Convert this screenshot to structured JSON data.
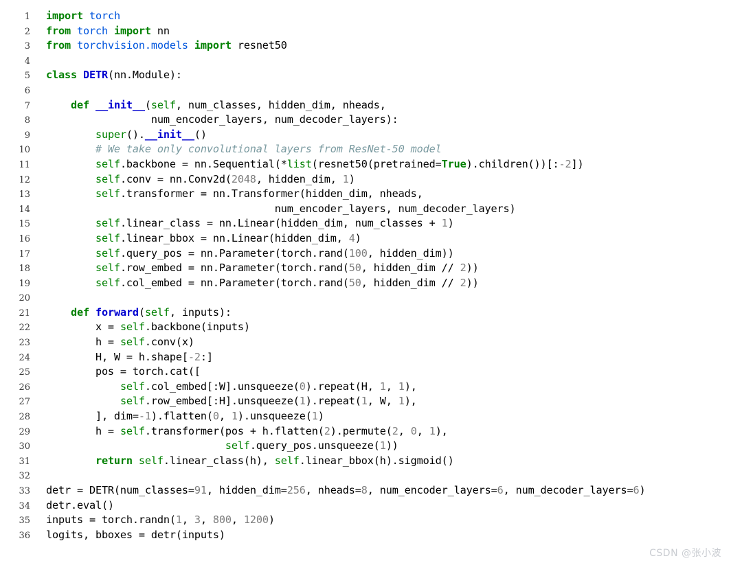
{
  "editor": {
    "language": "python",
    "background_color": "#ffffff",
    "line_number_color": "#3b3b3b",
    "first_line": 1,
    "last_line": 36,
    "total_lines": 36
  },
  "theme": {
    "keyword_color": "#008000",
    "name_color": "#0000d0",
    "module_color": "#0055dd",
    "number_color": "#7d7d7d",
    "comment_color": "#7a9aa0",
    "text_color": "#000000"
  },
  "watermark": {
    "text": "CSDN @张小波",
    "color": "#c9ccd1"
  },
  "lines": [
    {
      "n": "1",
      "tokens": [
        {
          "t": "import",
          "c": "kw"
        },
        {
          "t": " ",
          "c": "plain"
        },
        {
          "t": "torch",
          "c": "mod"
        }
      ]
    },
    {
      "n": "2",
      "tokens": [
        {
          "t": "from",
          "c": "kw"
        },
        {
          "t": " ",
          "c": "plain"
        },
        {
          "t": "torch",
          "c": "mod"
        },
        {
          "t": " ",
          "c": "plain"
        },
        {
          "t": "import",
          "c": "kw"
        },
        {
          "t": " nn",
          "c": "plain"
        }
      ]
    },
    {
      "n": "3",
      "tokens": [
        {
          "t": "from",
          "c": "kw"
        },
        {
          "t": " ",
          "c": "plain"
        },
        {
          "t": "torchvision.models",
          "c": "mod"
        },
        {
          "t": " ",
          "c": "plain"
        },
        {
          "t": "import",
          "c": "kw"
        },
        {
          "t": " resnet50",
          "c": "plain"
        }
      ]
    },
    {
      "n": "4",
      "tokens": []
    },
    {
      "n": "5",
      "tokens": [
        {
          "t": "class",
          "c": "kw"
        },
        {
          "t": " ",
          "c": "plain"
        },
        {
          "t": "DETR",
          "c": "name"
        },
        {
          "t": "(nn.Module):",
          "c": "plain"
        }
      ]
    },
    {
      "n": "6",
      "tokens": []
    },
    {
      "n": "7",
      "tokens": [
        {
          "t": "    ",
          "c": "plain"
        },
        {
          "t": "def",
          "c": "kw"
        },
        {
          "t": " ",
          "c": "plain"
        },
        {
          "t": "__init__",
          "c": "name"
        },
        {
          "t": "(",
          "c": "plain"
        },
        {
          "t": "self",
          "c": "self"
        },
        {
          "t": ", num_classes, hidden_dim, nheads,",
          "c": "plain"
        }
      ]
    },
    {
      "n": "8",
      "tokens": [
        {
          "t": "                 num_encoder_layers, num_decoder_layers):",
          "c": "plain"
        }
      ]
    },
    {
      "n": "9",
      "tokens": [
        {
          "t": "        ",
          "c": "plain"
        },
        {
          "t": "super",
          "c": "bi"
        },
        {
          "t": "().",
          "c": "plain"
        },
        {
          "t": "__init__",
          "c": "name"
        },
        {
          "t": "()",
          "c": "plain"
        }
      ]
    },
    {
      "n": "10",
      "tokens": [
        {
          "t": "        ",
          "c": "plain"
        },
        {
          "t": "# We take only convolutional layers from ResNet-50 model",
          "c": "com"
        }
      ]
    },
    {
      "n": "11",
      "tokens": [
        {
          "t": "        ",
          "c": "plain"
        },
        {
          "t": "self",
          "c": "self"
        },
        {
          "t": ".backbone = nn.Sequential(*",
          "c": "plain"
        },
        {
          "t": "list",
          "c": "bi"
        },
        {
          "t": "(resnet50(pretrained=",
          "c": "plain"
        },
        {
          "t": "True",
          "c": "bool"
        },
        {
          "t": ").children())[:",
          "c": "plain"
        },
        {
          "t": "-2",
          "c": "num"
        },
        {
          "t": "])",
          "c": "plain"
        }
      ]
    },
    {
      "n": "12",
      "tokens": [
        {
          "t": "        ",
          "c": "plain"
        },
        {
          "t": "self",
          "c": "self"
        },
        {
          "t": ".conv = nn.Conv2d(",
          "c": "plain"
        },
        {
          "t": "2048",
          "c": "num"
        },
        {
          "t": ", hidden_dim, ",
          "c": "plain"
        },
        {
          "t": "1",
          "c": "num"
        },
        {
          "t": ")",
          "c": "plain"
        }
      ]
    },
    {
      "n": "13",
      "tokens": [
        {
          "t": "        ",
          "c": "plain"
        },
        {
          "t": "self",
          "c": "self"
        },
        {
          "t": ".transformer = nn.Transformer(hidden_dim, nheads,",
          "c": "plain"
        }
      ]
    },
    {
      "n": "14",
      "tokens": [
        {
          "t": "                                     num_encoder_layers, num_decoder_layers)",
          "c": "plain"
        }
      ]
    },
    {
      "n": "15",
      "tokens": [
        {
          "t": "        ",
          "c": "plain"
        },
        {
          "t": "self",
          "c": "self"
        },
        {
          "t": ".linear_class = nn.Linear(hidden_dim, num_classes + ",
          "c": "plain"
        },
        {
          "t": "1",
          "c": "num"
        },
        {
          "t": ")",
          "c": "plain"
        }
      ]
    },
    {
      "n": "16",
      "tokens": [
        {
          "t": "        ",
          "c": "plain"
        },
        {
          "t": "self",
          "c": "self"
        },
        {
          "t": ".linear_bbox = nn.Linear(hidden_dim, ",
          "c": "plain"
        },
        {
          "t": "4",
          "c": "num"
        },
        {
          "t": ")",
          "c": "plain"
        }
      ]
    },
    {
      "n": "17",
      "tokens": [
        {
          "t": "        ",
          "c": "plain"
        },
        {
          "t": "self",
          "c": "self"
        },
        {
          "t": ".query_pos = nn.Parameter(torch.rand(",
          "c": "plain"
        },
        {
          "t": "100",
          "c": "num"
        },
        {
          "t": ", hidden_dim))",
          "c": "plain"
        }
      ]
    },
    {
      "n": "18",
      "tokens": [
        {
          "t": "        ",
          "c": "plain"
        },
        {
          "t": "self",
          "c": "self"
        },
        {
          "t": ".row_embed = nn.Parameter(torch.rand(",
          "c": "plain"
        },
        {
          "t": "50",
          "c": "num"
        },
        {
          "t": ", hidden_dim // ",
          "c": "plain"
        },
        {
          "t": "2",
          "c": "num"
        },
        {
          "t": "))",
          "c": "plain"
        }
      ]
    },
    {
      "n": "19",
      "tokens": [
        {
          "t": "        ",
          "c": "plain"
        },
        {
          "t": "self",
          "c": "self"
        },
        {
          "t": ".col_embed = nn.Parameter(torch.rand(",
          "c": "plain"
        },
        {
          "t": "50",
          "c": "num"
        },
        {
          "t": ", hidden_dim // ",
          "c": "plain"
        },
        {
          "t": "2",
          "c": "num"
        },
        {
          "t": "))",
          "c": "plain"
        }
      ]
    },
    {
      "n": "20",
      "tokens": []
    },
    {
      "n": "21",
      "tokens": [
        {
          "t": "    ",
          "c": "plain"
        },
        {
          "t": "def",
          "c": "kw"
        },
        {
          "t": " ",
          "c": "plain"
        },
        {
          "t": "forward",
          "c": "name"
        },
        {
          "t": "(",
          "c": "plain"
        },
        {
          "t": "self",
          "c": "self"
        },
        {
          "t": ", inputs):",
          "c": "plain"
        }
      ]
    },
    {
      "n": "22",
      "tokens": [
        {
          "t": "        x = ",
          "c": "plain"
        },
        {
          "t": "self",
          "c": "self"
        },
        {
          "t": ".backbone(inputs)",
          "c": "plain"
        }
      ]
    },
    {
      "n": "23",
      "tokens": [
        {
          "t": "        h = ",
          "c": "plain"
        },
        {
          "t": "self",
          "c": "self"
        },
        {
          "t": ".conv(x)",
          "c": "plain"
        }
      ]
    },
    {
      "n": "24",
      "tokens": [
        {
          "t": "        H, W = h.shape[",
          "c": "plain"
        },
        {
          "t": "-2",
          "c": "num"
        },
        {
          "t": ":]",
          "c": "plain"
        }
      ]
    },
    {
      "n": "25",
      "tokens": [
        {
          "t": "        pos = torch.cat([",
          "c": "plain"
        }
      ]
    },
    {
      "n": "26",
      "tokens": [
        {
          "t": "            ",
          "c": "plain"
        },
        {
          "t": "self",
          "c": "self"
        },
        {
          "t": ".col_embed[:W].unsqueeze(",
          "c": "plain"
        },
        {
          "t": "0",
          "c": "num"
        },
        {
          "t": ").repeat(H, ",
          "c": "plain"
        },
        {
          "t": "1",
          "c": "num"
        },
        {
          "t": ", ",
          "c": "plain"
        },
        {
          "t": "1",
          "c": "num"
        },
        {
          "t": "),",
          "c": "plain"
        }
      ]
    },
    {
      "n": "27",
      "tokens": [
        {
          "t": "            ",
          "c": "plain"
        },
        {
          "t": "self",
          "c": "self"
        },
        {
          "t": ".row_embed[:H].unsqueeze(",
          "c": "plain"
        },
        {
          "t": "1",
          "c": "num"
        },
        {
          "t": ").repeat(",
          "c": "plain"
        },
        {
          "t": "1",
          "c": "num"
        },
        {
          "t": ", W, ",
          "c": "plain"
        },
        {
          "t": "1",
          "c": "num"
        },
        {
          "t": "),",
          "c": "plain"
        }
      ]
    },
    {
      "n": "28",
      "tokens": [
        {
          "t": "        ], dim=",
          "c": "plain"
        },
        {
          "t": "-1",
          "c": "num"
        },
        {
          "t": ").flatten(",
          "c": "plain"
        },
        {
          "t": "0",
          "c": "num"
        },
        {
          "t": ", ",
          "c": "plain"
        },
        {
          "t": "1",
          "c": "num"
        },
        {
          "t": ").unsqueeze(",
          "c": "plain"
        },
        {
          "t": "1",
          "c": "num"
        },
        {
          "t": ")",
          "c": "plain"
        }
      ]
    },
    {
      "n": "29",
      "tokens": [
        {
          "t": "        h = ",
          "c": "plain"
        },
        {
          "t": "self",
          "c": "self"
        },
        {
          "t": ".transformer(pos + h.flatten(",
          "c": "plain"
        },
        {
          "t": "2",
          "c": "num"
        },
        {
          "t": ").permute(",
          "c": "plain"
        },
        {
          "t": "2",
          "c": "num"
        },
        {
          "t": ", ",
          "c": "plain"
        },
        {
          "t": "0",
          "c": "num"
        },
        {
          "t": ", ",
          "c": "plain"
        },
        {
          "t": "1",
          "c": "num"
        },
        {
          "t": "),",
          "c": "plain"
        }
      ]
    },
    {
      "n": "30",
      "tokens": [
        {
          "t": "                             ",
          "c": "plain"
        },
        {
          "t": "self",
          "c": "self"
        },
        {
          "t": ".query_pos.unsqueeze(",
          "c": "plain"
        },
        {
          "t": "1",
          "c": "num"
        },
        {
          "t": "))",
          "c": "plain"
        }
      ]
    },
    {
      "n": "31",
      "tokens": [
        {
          "t": "        ",
          "c": "plain"
        },
        {
          "t": "return",
          "c": "kw"
        },
        {
          "t": " ",
          "c": "plain"
        },
        {
          "t": "self",
          "c": "self"
        },
        {
          "t": ".linear_class(h), ",
          "c": "plain"
        },
        {
          "t": "self",
          "c": "self"
        },
        {
          "t": ".linear_bbox(h).sigmoid()",
          "c": "plain"
        }
      ]
    },
    {
      "n": "32",
      "tokens": []
    },
    {
      "n": "33",
      "tokens": [
        {
          "t": "detr = DETR(num_classes=",
          "c": "plain"
        },
        {
          "t": "91",
          "c": "num"
        },
        {
          "t": ", hidden_dim=",
          "c": "plain"
        },
        {
          "t": "256",
          "c": "num"
        },
        {
          "t": ", nheads=",
          "c": "plain"
        },
        {
          "t": "8",
          "c": "num"
        },
        {
          "t": ", num_encoder_layers=",
          "c": "plain"
        },
        {
          "t": "6",
          "c": "num"
        },
        {
          "t": ", num_decoder_layers=",
          "c": "plain"
        },
        {
          "t": "6",
          "c": "num"
        },
        {
          "t": ")",
          "c": "plain"
        }
      ]
    },
    {
      "n": "34",
      "tokens": [
        {
          "t": "detr.eval()",
          "c": "plain"
        }
      ]
    },
    {
      "n": "35",
      "tokens": [
        {
          "t": "inputs = torch.randn(",
          "c": "plain"
        },
        {
          "t": "1",
          "c": "num"
        },
        {
          "t": ", ",
          "c": "plain"
        },
        {
          "t": "3",
          "c": "num"
        },
        {
          "t": ", ",
          "c": "plain"
        },
        {
          "t": "800",
          "c": "num"
        },
        {
          "t": ", ",
          "c": "plain"
        },
        {
          "t": "1200",
          "c": "num"
        },
        {
          "t": ")",
          "c": "plain"
        }
      ]
    },
    {
      "n": "36",
      "tokens": [
        {
          "t": "logits, bboxes = detr(inputs)",
          "c": "plain"
        }
      ]
    }
  ]
}
